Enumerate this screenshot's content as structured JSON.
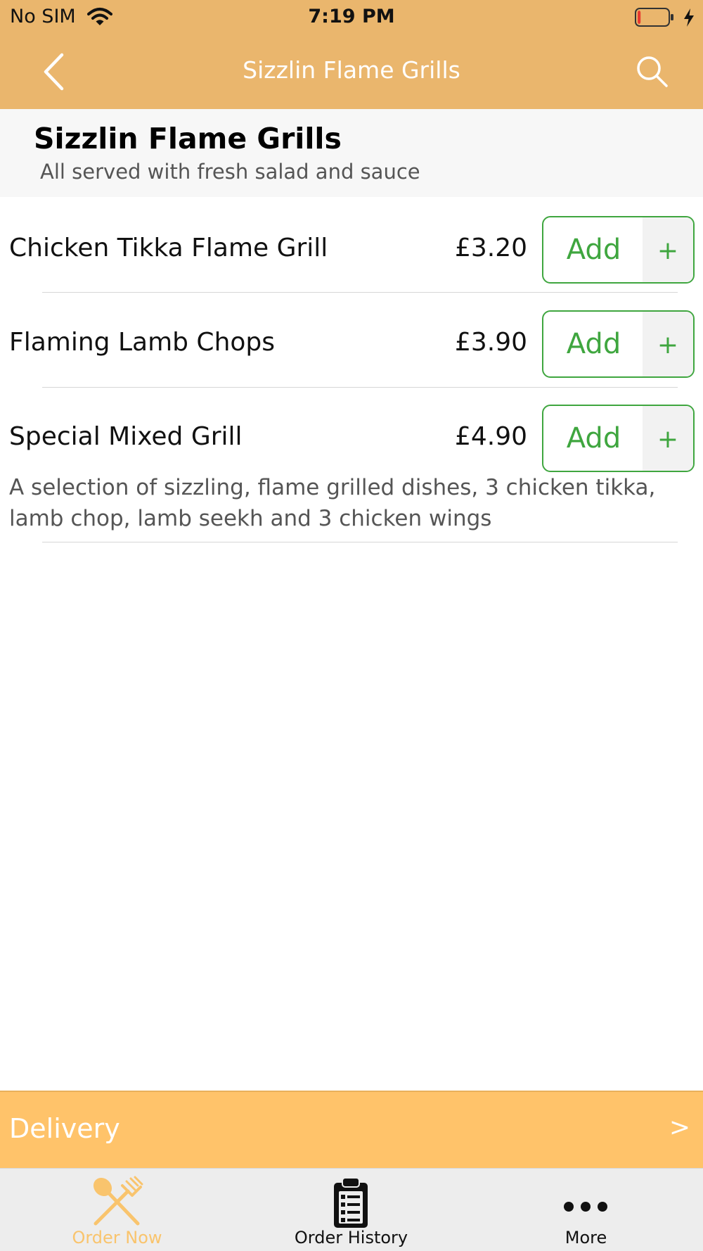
{
  "status_bar": {
    "carrier": "No SIM",
    "time": "7:19 PM",
    "battery_level": 0.1
  },
  "nav": {
    "title": "Sizzlin Flame Grills"
  },
  "section": {
    "title": "Sizzlin Flame Grills",
    "subtitle": "All served with fresh salad and sauce"
  },
  "items": [
    {
      "name": "Chicken Tikka Flame Grill",
      "price": "£3.20",
      "add_label": "Add",
      "plus_label": "+"
    },
    {
      "name": "Flaming Lamb Chops",
      "price": "£3.90",
      "add_label": "Add",
      "plus_label": "+"
    },
    {
      "name": "Special Mixed Grill",
      "price": "£4.90",
      "add_label": "Add",
      "plus_label": "+",
      "description": "A selection of sizzling, flame grilled dishes, 3 chicken tikka, lamb chop, lamb seekh and 3 chicken wings"
    }
  ],
  "delivery": {
    "label": "Delivery",
    "arrow": ">"
  },
  "tabs": [
    {
      "label": "Order Now",
      "icon": "cutlery-icon",
      "active": true
    },
    {
      "label": "Order History",
      "icon": "clipboard-icon",
      "active": false
    },
    {
      "label": "More",
      "icon": "more-dots-icon",
      "active": false
    }
  ],
  "colors": {
    "header_bg": "#EAB66D",
    "accent_green": "#3FA63F",
    "delivery_bg": "#FFC36A",
    "tab_active": "#F9C46D",
    "battery_low": "#E8392E"
  }
}
